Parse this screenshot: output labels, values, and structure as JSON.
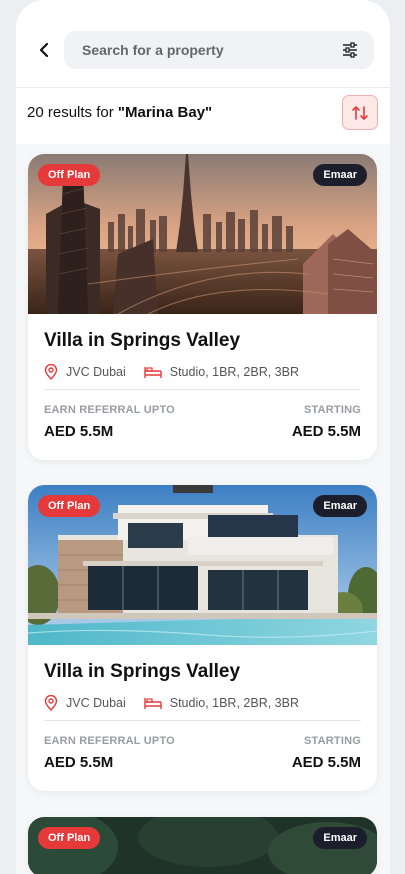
{
  "header": {
    "search_placeholder": "Search for a property",
    "back_icon": "chevron-left-icon",
    "filter_icon": "sliders-icon"
  },
  "results": {
    "count": "20",
    "text": "results for",
    "query": "\"Marina Bay\"",
    "sort_icon": "sort-arrows-icon"
  },
  "colors": {
    "accent_red": "#e63939",
    "badge_dark": "#1c1f2b",
    "sort_bg": "#fde8e8"
  },
  "listings": [
    {
      "status_badge": "Off Plan",
      "developer_badge": "Emaar",
      "image": "dubai-skyline-photo",
      "title": "Villa in Springs Valley",
      "location": "JVC Dubai",
      "bedrooms": "Studio, 1BR, 2BR, 3BR",
      "referral_label": "EARN REFERRAL UPTO",
      "referral_value": "AED 5.5M",
      "starting_label": "STARTING",
      "starting_value": "AED 5.5M"
    },
    {
      "status_badge": "Off Plan",
      "developer_badge": "Emaar",
      "image": "modern-villa-pool-photo",
      "title": "Villa in Springs Valley",
      "location": "JVC Dubai",
      "bedrooms": "Studio, 1BR, 2BR, 3BR",
      "referral_label": "EARN REFERRAL UPTO",
      "referral_value": "AED 5.5M",
      "starting_label": "STARTING",
      "starting_value": "AED 5.5M"
    },
    {
      "status_badge": "Off Plan",
      "developer_badge": "Emaar",
      "image": "forest-photo"
    }
  ]
}
